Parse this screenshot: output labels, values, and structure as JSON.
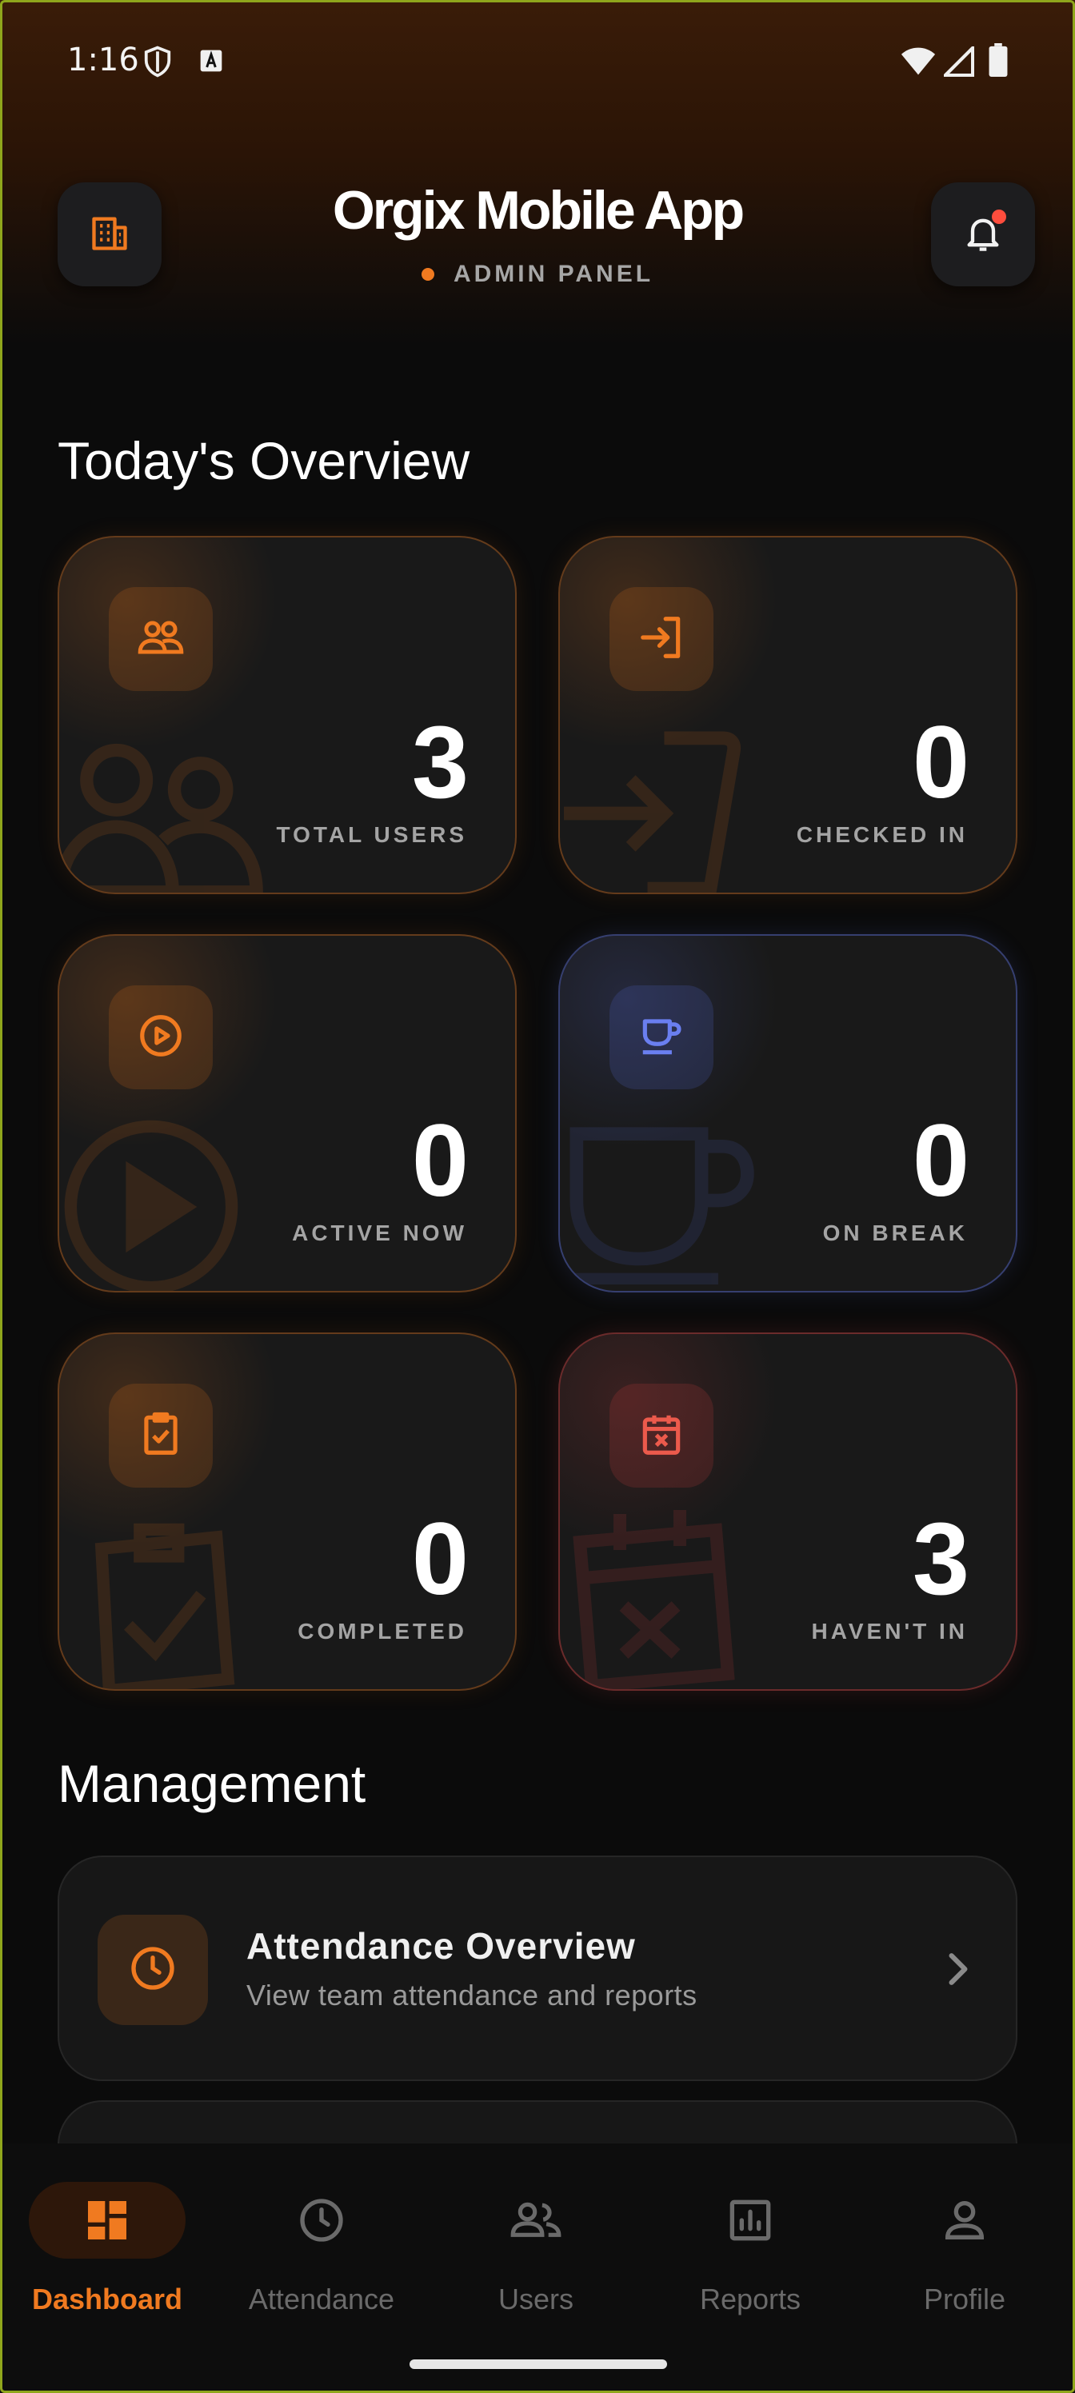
{
  "status_bar": {
    "time": "1:16"
  },
  "header": {
    "title": "Orgix Mobile App",
    "subtitle": "ADMIN PANEL",
    "left_icon": "building-icon",
    "right_icon": "bell-icon"
  },
  "overview": {
    "title": "Today's Overview",
    "cards": [
      {
        "value": "3",
        "label": "TOTAL USERS",
        "icon": "users-icon",
        "accent": "#f07a20"
      },
      {
        "value": "0",
        "label": "CHECKED IN",
        "icon": "login-icon",
        "accent": "#f07a20"
      },
      {
        "value": "0",
        "label": "ACTIVE NOW",
        "icon": "play-circle-icon",
        "accent": "#f07a20"
      },
      {
        "value": "0",
        "label": "ON BREAK",
        "icon": "coffee-icon",
        "accent": "#5a6edc"
      },
      {
        "value": "0",
        "label": "COMPLETED",
        "icon": "clipboard-check-icon",
        "accent": "#f07a20"
      },
      {
        "value": "3",
        "label": "HAVEN'T IN",
        "icon": "calendar-x-icon",
        "accent": "#e64646"
      }
    ]
  },
  "management": {
    "title": "Management",
    "items": [
      {
        "title": "Attendance Overview",
        "description": "View team attendance and reports",
        "icon": "clock-icon"
      }
    ]
  },
  "bottom_nav": {
    "items": [
      {
        "label": "Dashboard",
        "icon": "dashboard-icon",
        "active": true
      },
      {
        "label": "Attendance",
        "icon": "clock-icon",
        "active": false
      },
      {
        "label": "Users",
        "icon": "users-icon",
        "active": false
      },
      {
        "label": "Reports",
        "icon": "bar-chart-icon",
        "active": false
      },
      {
        "label": "Profile",
        "icon": "person-icon",
        "active": false
      }
    ]
  },
  "colors": {
    "accent": "#f07a20",
    "blue_accent": "#5a6edc",
    "red_accent": "#e64646",
    "background": "#0b0b0b"
  }
}
